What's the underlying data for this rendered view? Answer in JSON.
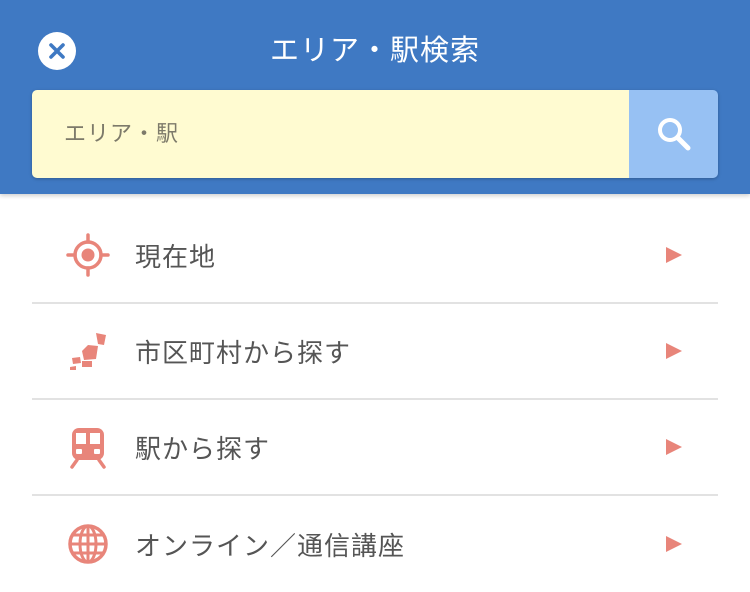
{
  "header": {
    "title": "エリア・駅検索",
    "close_icon": "close-icon"
  },
  "search": {
    "placeholder": "エリア・駅",
    "value": "",
    "button_icon": "search-icon"
  },
  "menu": {
    "items": [
      {
        "label": "現在地",
        "icon": "location-target-icon"
      },
      {
        "label": "市区町村から探す",
        "icon": "map-icon"
      },
      {
        "label": "駅から探す",
        "icon": "train-icon"
      },
      {
        "label": "オンライン／通信講座",
        "icon": "globe-icon"
      }
    ],
    "arrow_icon": "triangle-right-icon"
  },
  "colors": {
    "header_bg": "#3f79c3",
    "search_input_bg": "#fffbd1",
    "search_button_bg": "#97c1f3",
    "accent": "#e8857a",
    "label_text": "#555555"
  }
}
